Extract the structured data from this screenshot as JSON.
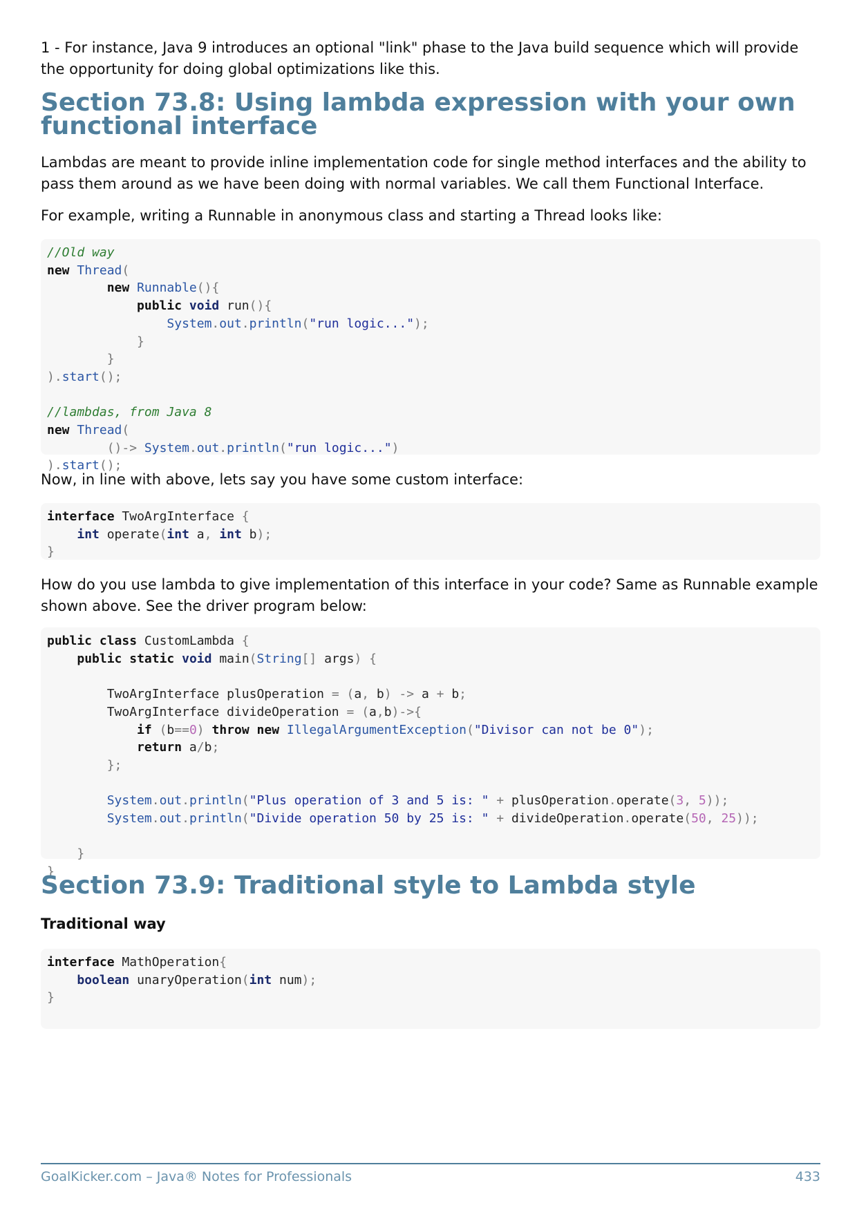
{
  "intro": {
    "footnote": "1 - For instance, Java 9 introduces an optional \"link\" phase to the Java build sequence which will provide the opportunity for doing global optimizations like this."
  },
  "section1": {
    "title": "Section 73.8: Using lambda expression with your own functional interface",
    "para1": "Lambdas are meant to provide inline implementation code for single method interfaces and the ability to pass them around as we have been doing with normal variables. We call them Functional Interface.",
    "para2": "For example, writing a Runnable in anonymous class and starting a Thread looks like:",
    "para3": "Now, in line with above, lets say you have some custom interface:",
    "para4": "How do you use lambda to give implementation of this interface in your code? Same as Runnable example shown above. See the driver program below:"
  },
  "code1": {
    "l1": "//Old way",
    "l2": "new",
    "l2b": "Thread",
    "l3": "new",
    "l3b": "Runnable",
    "l4a": "public",
    "l4b": "void",
    "l4c": "run",
    "l5a": "System",
    "l5b": "out",
    "l5c": "println",
    "l5d": "\"run logic...\"",
    "l8": "start",
    "l10": "//lambdas, from Java 8",
    "l11a": "new",
    "l11b": "Thread",
    "l12a": "System",
    "l12b": "out",
    "l12c": "println",
    "l12d": "\"run logic...\"",
    "l13": "start"
  },
  "code2": {
    "a1": "interface",
    "a2": "TwoArgInterface",
    "b1": "int",
    "b2": "operate",
    "b3": "int",
    "b4": "a",
    "b5": "int",
    "b6": "b"
  },
  "code3": {
    "a1": "public",
    "a2": "class",
    "a3": "CustomLambda",
    "b1": "public",
    "b2": "static",
    "b3": "void",
    "b4": "main",
    "b5": "String",
    "b6": "args",
    "c1": "TwoArgInterface plusOperation",
    "c2": "a",
    "c3": "b",
    "c4": "a",
    "c5": "b",
    "d1": "TwoArgInterface divideOperation",
    "d2": "a",
    "d3": "b",
    "e1": "if",
    "e2": "b",
    "e3": "0",
    "e4": "throw",
    "e5": "new",
    "e6": "IllegalArgumentException",
    "e7": "\"Divisor can not be 0\"",
    "f1": "return",
    "f2": "a",
    "f3": "b",
    "g1": "System",
    "g2": "out",
    "g3": "println",
    "g4": "\"Plus operation of 3 and 5 is: \"",
    "g5": "plusOperation",
    "g6": "operate",
    "g7": "3",
    "g8": "5",
    "h1": "System",
    "h2": "out",
    "h3": "println",
    "h4": "\"Divide operation 50 by 25 is: \"",
    "h5": "divideOperation",
    "h6": "operate",
    "h7": "50",
    "h8": "25"
  },
  "section2": {
    "title": "Section 73.9: Traditional style to Lambda style",
    "subtitle": "Traditional way"
  },
  "code4": {
    "a1": "interface",
    "a2": "MathOperation",
    "b1": "boolean",
    "b2": "unaryOperation",
    "b3": "int",
    "b4": "num"
  },
  "footer": {
    "left": "GoalKicker.com – Java® Notes for Professionals",
    "right": "433"
  }
}
